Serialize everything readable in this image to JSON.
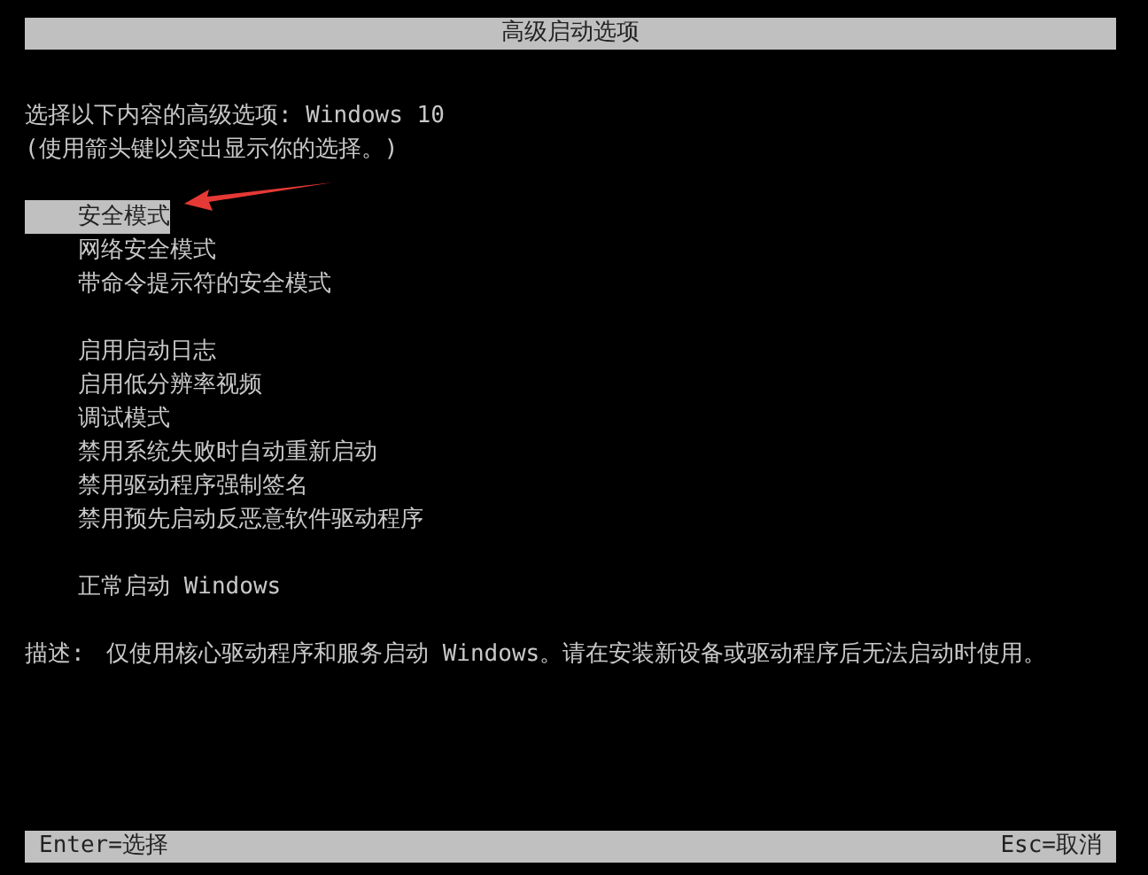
{
  "title": "高级启动选项",
  "intro": [
    "选择以下内容的高级选项: Windows 10",
    "(使用箭头键以突出显示你的选择。)"
  ],
  "option_groups": [
    [
      {
        "label": "安全模式",
        "selected": true
      },
      {
        "label": "网络安全模式",
        "selected": false
      },
      {
        "label": "带命令提示符的安全模式",
        "selected": false
      }
    ],
    [
      {
        "label": "启用启动日志",
        "selected": false
      },
      {
        "label": "启用低分辨率视频",
        "selected": false
      },
      {
        "label": "调试模式",
        "selected": false
      },
      {
        "label": "禁用系统失败时自动重新启动",
        "selected": false
      },
      {
        "label": "禁用驱动程序强制签名",
        "selected": false
      },
      {
        "label": "禁用预先启动反恶意软件驱动程序",
        "selected": false
      }
    ],
    [
      {
        "label": "正常启动 Windows",
        "selected": false
      }
    ]
  ],
  "description": {
    "label": "描述:",
    "text": "仅使用核心驱动程序和服务启动 Windows。请在安装新设备或驱动程序后无法启动时使用。"
  },
  "footer": {
    "left": "Enter=选择",
    "right": "Esc=取消"
  }
}
